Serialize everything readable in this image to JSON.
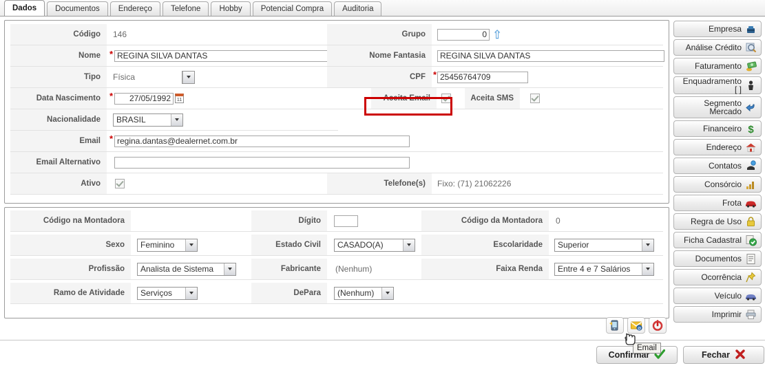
{
  "tabs": [
    {
      "label": "Dados",
      "active": true
    },
    {
      "label": "Documentos",
      "active": false
    },
    {
      "label": "Endereço",
      "active": false
    },
    {
      "label": "Telefone",
      "active": false
    },
    {
      "label": "Hobby",
      "active": false
    },
    {
      "label": "Potencial Compra",
      "active": false
    },
    {
      "label": "Auditoria",
      "active": false
    }
  ],
  "form": {
    "codigo": {
      "label": "Código",
      "value": "146"
    },
    "grupo": {
      "label": "Grupo",
      "value": "0"
    },
    "nome": {
      "label": "Nome",
      "value": "REGINA SILVA DANTAS",
      "required": "*"
    },
    "nome_fantasia": {
      "label": "Nome Fantasia",
      "value": "REGINA SILVA DANTAS"
    },
    "tipo": {
      "label": "Tipo",
      "value": "Física"
    },
    "cpf": {
      "label": "CPF",
      "value": "25456764709",
      "required": "*"
    },
    "data_nascimento": {
      "label": "Data Nascimento",
      "value": "27/05/1992",
      "required": "*",
      "cal": "11"
    },
    "aceita_email": {
      "label": "Aceita Email",
      "checked": true
    },
    "aceita_sms": {
      "label": "Aceita SMS",
      "checked": true
    },
    "nacionalidade": {
      "label": "Nacionalidade",
      "value": "BRASIL"
    },
    "email": {
      "label": "Email",
      "value": "regina.dantas@dealernet.com.br",
      "required": "*"
    },
    "email_alternativo": {
      "label": "Email Alternativo",
      "value": ""
    },
    "ativo": {
      "label": "Ativo",
      "checked": true
    },
    "telefones": {
      "label": "Telefone(s)",
      "value": "Fixo: (71) 21062226"
    }
  },
  "form2": {
    "codigo_montadora_cli": {
      "label": "Código na Montadora",
      "value": ""
    },
    "digito": {
      "label": "Dígito",
      "value": ""
    },
    "codigo_da_montadora": {
      "label": "Código da Montadora",
      "value": "0"
    },
    "sexo": {
      "label": "Sexo",
      "value": "Feminino"
    },
    "estado_civil": {
      "label": "Estado Civil",
      "value": "CASADO(A)"
    },
    "escolaridade": {
      "label": "Escolaridade",
      "value": "Superior"
    },
    "profissao": {
      "label": "Profissão",
      "value": "Analista de Sistema"
    },
    "fabricante": {
      "label": "Fabricante",
      "value": "(Nenhum)"
    },
    "faixa_renda": {
      "label": "Faixa Renda",
      "value": "Entre 4 e 7 Salários"
    },
    "ramo_atividade": {
      "label": "Ramo de Atividade",
      "value": "Serviços"
    },
    "depara": {
      "label": "DePara",
      "value": "(Nenhum)"
    }
  },
  "sidebar": [
    {
      "label": "Empresa",
      "icon": "briefcase-icon",
      "lines": 1
    },
    {
      "label": "Análise Crédito",
      "icon": "magnifier-icon",
      "lines": 1
    },
    {
      "label": "Faturamento",
      "icon": "money-icon",
      "lines": 1
    },
    {
      "label": "Enquadramento [ ]",
      "icon": "person-icon",
      "lines": 1
    },
    {
      "label": "Segmento Mercado",
      "icon": "blue-arrow-icon",
      "lines": 2
    },
    {
      "label": "Financeiro",
      "icon": "dollar-icon",
      "lines": 1
    },
    {
      "label": "Endereço",
      "icon": "house-icon",
      "lines": 1
    },
    {
      "label": "Contatos",
      "icon": "phone-icon",
      "lines": 1
    },
    {
      "label": "Consórcio",
      "icon": "chart-icon",
      "lines": 1
    },
    {
      "label": "Frota",
      "icon": "red-car-icon",
      "lines": 1
    },
    {
      "label": "Regra de Uso",
      "icon": "padlock-icon",
      "lines": 1
    },
    {
      "label": "Ficha Cadastral",
      "icon": "check-badge-icon",
      "lines": 1
    },
    {
      "label": "Documentos",
      "icon": "document-icon",
      "lines": 1
    },
    {
      "label": "Ocorrência",
      "icon": "pushpin-icon",
      "lines": 1
    },
    {
      "label": "Veículo",
      "icon": "blue-car-icon",
      "lines": 1
    },
    {
      "label": "Imprimir",
      "icon": "printer-icon",
      "lines": 1
    }
  ],
  "actions": [
    {
      "name": "sms-icon"
    },
    {
      "name": "email-icon"
    },
    {
      "name": "power-icon"
    }
  ],
  "tooltip": {
    "text": "Email"
  },
  "footer": {
    "confirm": "Confirmar",
    "close": "Fechar"
  },
  "colors": {
    "required": "#cc0000",
    "annotation": "#cc0000",
    "label_text": "#555555",
    "panel_border": "#9b9b9b"
  }
}
